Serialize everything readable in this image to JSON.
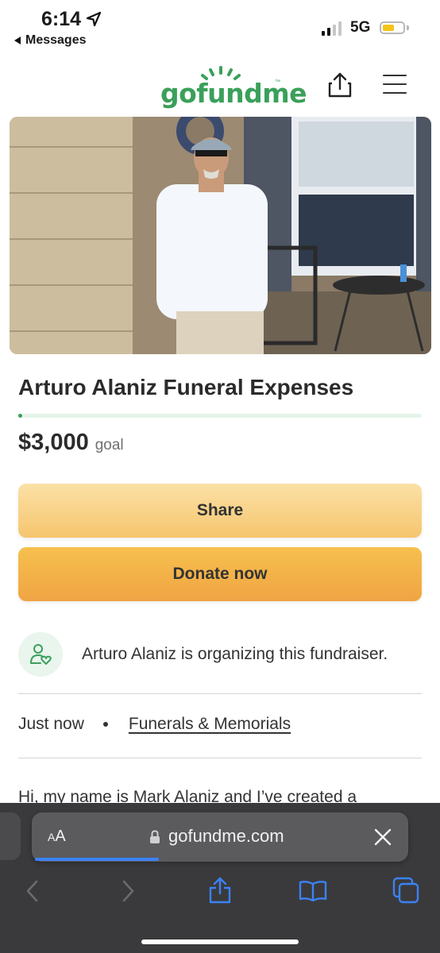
{
  "status_bar": {
    "time": "6:14",
    "back_label": "Messages",
    "network": "5G",
    "signal_bars_filled": 2,
    "battery_level": 0.6
  },
  "header": {
    "logo_text": "gofundme",
    "logo_trademark": "™"
  },
  "campaign": {
    "title": "Arturo Alaniz Funeral Expenses",
    "progress_fraction": 0.01,
    "goal_amount": "$3,000",
    "goal_label": "goal",
    "share_label": "Share",
    "donate_label": "Donate now",
    "organizer_text": "Arturo Alaniz is organizing this fundraiser.",
    "posted_time": "Just now",
    "category": "Funerals & Memorials",
    "story_preview": "Hi, my name is Mark Alaniz and I’ve created a"
  },
  "safari": {
    "text_size_label_small": "A",
    "text_size_label_large": "A",
    "url": "gofundme.com"
  },
  "colors": {
    "brand_green": "#3aa05a",
    "share_button": "#f8d38a",
    "donate_button": "#f2b247",
    "toolbar": "#3a3a3c",
    "toolbar_accent": "#3b82f6"
  },
  "icons": [
    "location-arrow-icon",
    "share-icon",
    "menu-icon",
    "organizer-heart-icon",
    "lock-icon",
    "close-icon",
    "back-icon",
    "forward-icon",
    "share-sheet-icon",
    "bookmarks-icon",
    "tabs-icon"
  ]
}
